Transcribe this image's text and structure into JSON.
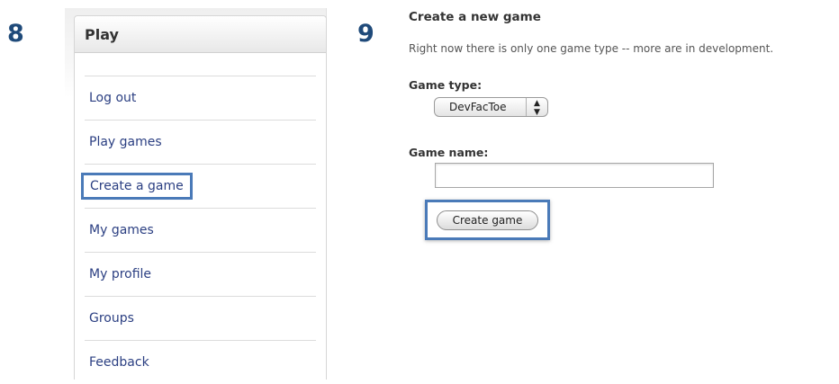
{
  "steps": {
    "left": "8",
    "right": "9"
  },
  "sidebar": {
    "header": "Play",
    "items": [
      {
        "label": "Log out"
      },
      {
        "label": "Play games"
      },
      {
        "label": "Create a game"
      },
      {
        "label": "My games"
      },
      {
        "label": "My profile"
      },
      {
        "label": "Groups"
      },
      {
        "label": "Feedback"
      }
    ]
  },
  "form": {
    "title": "Create a new game",
    "subtitle": "Right now there is only one game type -- more are in development.",
    "game_type_label": "Game type:",
    "game_type_value": "DevFacToe",
    "game_name_label": "Game name:",
    "game_name_value": "",
    "submit_label": "Create game"
  },
  "colors": {
    "highlight_border": "#4a7ab8",
    "link": "#2b3f82",
    "step_number": "#1f4a7a"
  }
}
